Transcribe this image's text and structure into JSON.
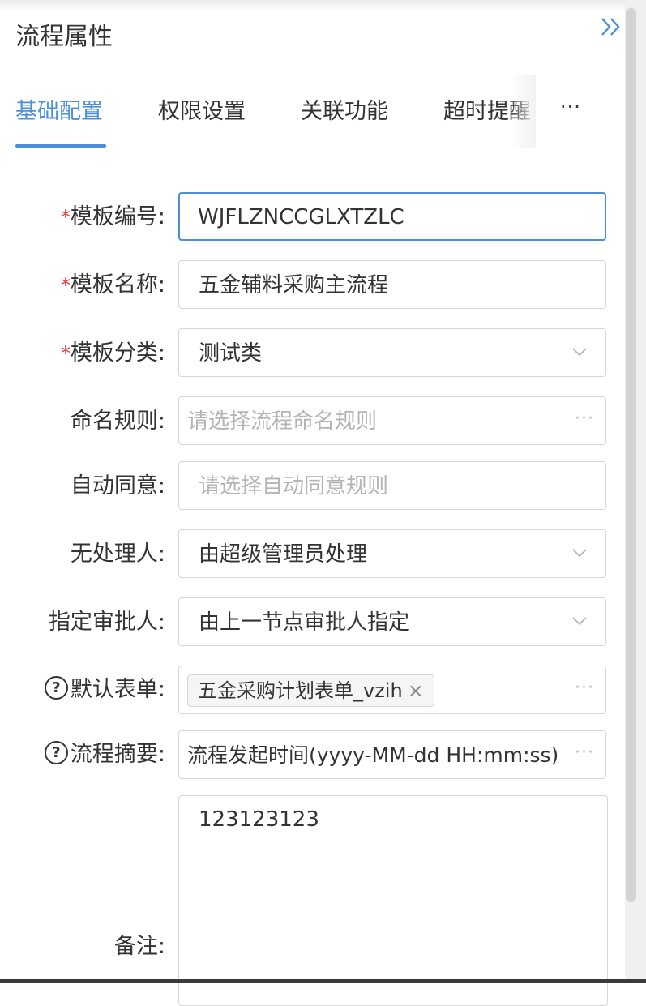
{
  "panel": {
    "title": "流程属性"
  },
  "tabs": {
    "items": [
      "基础配置",
      "权限设置",
      "关联功能",
      "超时提醒"
    ],
    "more": "···",
    "active": "基础配置"
  },
  "form": {
    "template_code": {
      "label": "模板编号:",
      "value": "WJFLZNCCGLXTZLC",
      "required_mark": "*"
    },
    "template_name": {
      "label": "模板名称:",
      "value": "五金辅料采购主流程",
      "required_mark": "*"
    },
    "template_category": {
      "label": "模板分类:",
      "value": "测试类",
      "required_mark": "*"
    },
    "naming_rule": {
      "label": "命名规则:",
      "placeholder": "请选择流程命名规则",
      "more": "···"
    },
    "auto_approve": {
      "label": "自动同意:",
      "placeholder": "请选择自动同意规则"
    },
    "no_handler": {
      "label": "无处理人:",
      "value": "由超级管理员处理"
    },
    "assign_approver": {
      "label": "指定审批人:",
      "value": "由上一节点审批人指定"
    },
    "default_form": {
      "label": "默认表单:",
      "help": "?",
      "tag": "五金采购计划表单_vzih",
      "tag_close": "×",
      "more": "···"
    },
    "summary": {
      "label": "流程摘要:",
      "help": "?",
      "value": "流程发起时间(yyyy-MM-dd HH:mm:ss)",
      "more": "···"
    },
    "remark": {
      "label": "备注:",
      "value": "123123123"
    }
  },
  "colors": {
    "accent": "#4a8fdc",
    "required": "#e03c3c",
    "placeholder": "#b4b4b4"
  }
}
